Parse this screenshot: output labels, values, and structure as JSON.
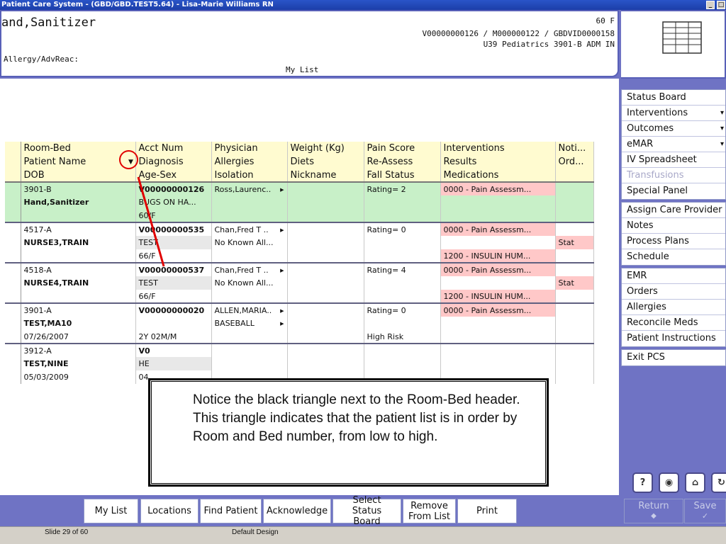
{
  "window": {
    "title": "Patient Care System - (GBD/GBD.TEST5.64) - Lisa-Marie Williams RN"
  },
  "header": {
    "patient_name": "and,Sanitizer",
    "allergy_label": "Allergy/AdvReac:",
    "age_sex": "60 F",
    "ids": "V00000000126 / M000000122 / GBDVID0000158",
    "location": "U39 Pediatrics  3901-B  ADM IN",
    "list_name": "My List"
  },
  "table": {
    "headers": [
      [
        "Room-Bed",
        "Acct Num",
        "Physician",
        "Weight (Kg)",
        "Pain Score",
        "Interventions",
        "Noti..."
      ],
      [
        "Patient Name",
        "Diagnosis",
        "Allergies",
        "Diets",
        "Re-Assess",
        "Results",
        "Ord..."
      ],
      [
        "DOB",
        "Age-Sex",
        "Isolation",
        "Nickname",
        "Fall Status",
        "Medications",
        ""
      ]
    ],
    "patients": [
      {
        "rows": [
          [
            "3901-B",
            "V00000000126",
            "Ross,Laurenc..",
            "",
            "Rating= 2",
            "0000 - Pain Assessm...",
            ""
          ],
          [
            "Hand,Sanitizer",
            "BUGS ON HA...",
            "",
            "",
            "",
            "",
            ""
          ],
          [
            "",
            "60/F",
            "",
            "",
            "",
            "",
            ""
          ]
        ]
      },
      {
        "rows": [
          [
            "4517-A",
            "V00000000535",
            "Chan,Fred T ..",
            "",
            "Rating= 0",
            "0000 - Pain Assessm...",
            ""
          ],
          [
            "NURSE3,TRAIN",
            "TEST",
            "No Known All...",
            "",
            "",
            "",
            "Stat"
          ],
          [
            "",
            "66/F",
            "",
            "",
            "",
            "1200 - INSULIN HUM...",
            ""
          ]
        ]
      },
      {
        "rows": [
          [
            "4518-A",
            "V00000000537",
            "Chan,Fred T ..",
            "",
            "Rating= 4",
            "0000 - Pain Assessm...",
            ""
          ],
          [
            "NURSE4,TRAIN",
            "TEST",
            "No Known All...",
            "",
            "",
            "",
            "Stat"
          ],
          [
            "",
            "66/F",
            "",
            "",
            "",
            "1200 - INSULIN HUM...",
            ""
          ]
        ]
      },
      {
        "rows": [
          [
            "3901-A",
            "V00000000020",
            "ALLEN,MARIA..",
            "",
            "Rating= 0",
            "0000 - Pain Assessm...",
            ""
          ],
          [
            "TEST,MA10",
            "",
            "BASEBALL",
            "",
            "",
            "",
            ""
          ],
          [
            "07/26/2007",
            "2Y 02M/M",
            "",
            "",
            "High Risk",
            "",
            ""
          ]
        ]
      },
      {
        "rows": [
          [
            "3912-A",
            "V0",
            "",
            "",
            "",
            "",
            ""
          ],
          [
            "TEST,NINE",
            "HE",
            "",
            "",
            "",
            "",
            ""
          ],
          [
            "05/03/2009",
            "04",
            "",
            "",
            "",
            "",
            ""
          ]
        ]
      }
    ]
  },
  "callout": {
    "text": "Notice the black triangle next to the Room-Bed header. This triangle indicates that the patient list is in order by Room and Bed number, from low to high."
  },
  "nav": {
    "groups": [
      [
        "Status Board",
        "Interventions",
        "Outcomes",
        "eMAR",
        "IV Spreadsheet",
        "Transfusions",
        "Special Panel"
      ],
      [
        "Assign Care Provider",
        "Notes",
        "Process Plans",
        "Schedule"
      ],
      [
        "EMR",
        "Orders",
        "Allergies",
        "Reconcile Meds",
        "Patient Instructions"
      ],
      [
        "Exit PCS"
      ]
    ]
  },
  "util": {
    "help": "?"
  },
  "bottom": {
    "buttons": [
      "My List",
      "Locations",
      "Find Patient",
      "Acknowledge",
      "Select Status Board",
      "Remove From List",
      "Print"
    ],
    "return_label": "Return",
    "save_label": "Save"
  },
  "statusbar": {
    "slide": "Slide 29 of 60",
    "design": "Default Design"
  }
}
